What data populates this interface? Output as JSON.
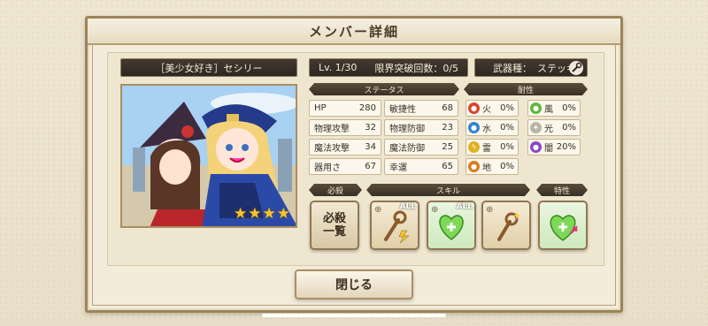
{
  "title": "メンバー詳細",
  "character": {
    "name": "［美少女好き］セシリー",
    "stars": [
      "★",
      "★",
      "★",
      "★"
    ]
  },
  "level": {
    "lv": "Lv. 1/30",
    "limit_break": "限界突破回数：0/5"
  },
  "weapon": {
    "label": "武器種：",
    "type": "ステッキ",
    "icon": "wrench-icon"
  },
  "status": {
    "header": "ステータス",
    "rows": [
      {
        "left_label": "HP",
        "left_value": "280",
        "right_label": "敏捷性",
        "right_value": "68"
      },
      {
        "left_label": "物理攻撃",
        "left_value": "32",
        "right_label": "物理防御",
        "right_value": "23"
      },
      {
        "left_label": "魔法攻撃",
        "left_value": "34",
        "right_label": "魔法防御",
        "right_value": "25"
      },
      {
        "left_label": "器用さ",
        "left_value": "67",
        "right_label": "幸運",
        "right_value": "65"
      }
    ]
  },
  "resistance": {
    "header": "耐性",
    "items": [
      {
        "label": "火",
        "value": "0%",
        "color": "#d9452b",
        "icon": "fire-icon"
      },
      {
        "label": "風",
        "value": "0%",
        "color": "#5cb83a",
        "icon": "wind-icon"
      },
      {
        "label": "水",
        "value": "0%",
        "color": "#2f86d1",
        "icon": "water-icon"
      },
      {
        "label": "光",
        "value": "0%",
        "color": "#b9b5a8",
        "icon": "light-icon"
      },
      {
        "label": "雷",
        "value": "0%",
        "color": "#e0b21f",
        "icon": "thunder-icon"
      },
      {
        "label": "闇",
        "value": "20%",
        "color": "#8d47c4",
        "icon": "dark-icon"
      },
      {
        "label": "地",
        "value": "0%",
        "color": "#d97a1f",
        "icon": "earth-icon"
      }
    ]
  },
  "sections": {
    "special": "必殺",
    "skill": "スキル",
    "trait": "特性"
  },
  "skills": {
    "special_button": "必殺一覧",
    "all_tag": "ALL"
  },
  "close_button": "閉じる",
  "nav": {
    "prev": "‹",
    "next": "›"
  }
}
